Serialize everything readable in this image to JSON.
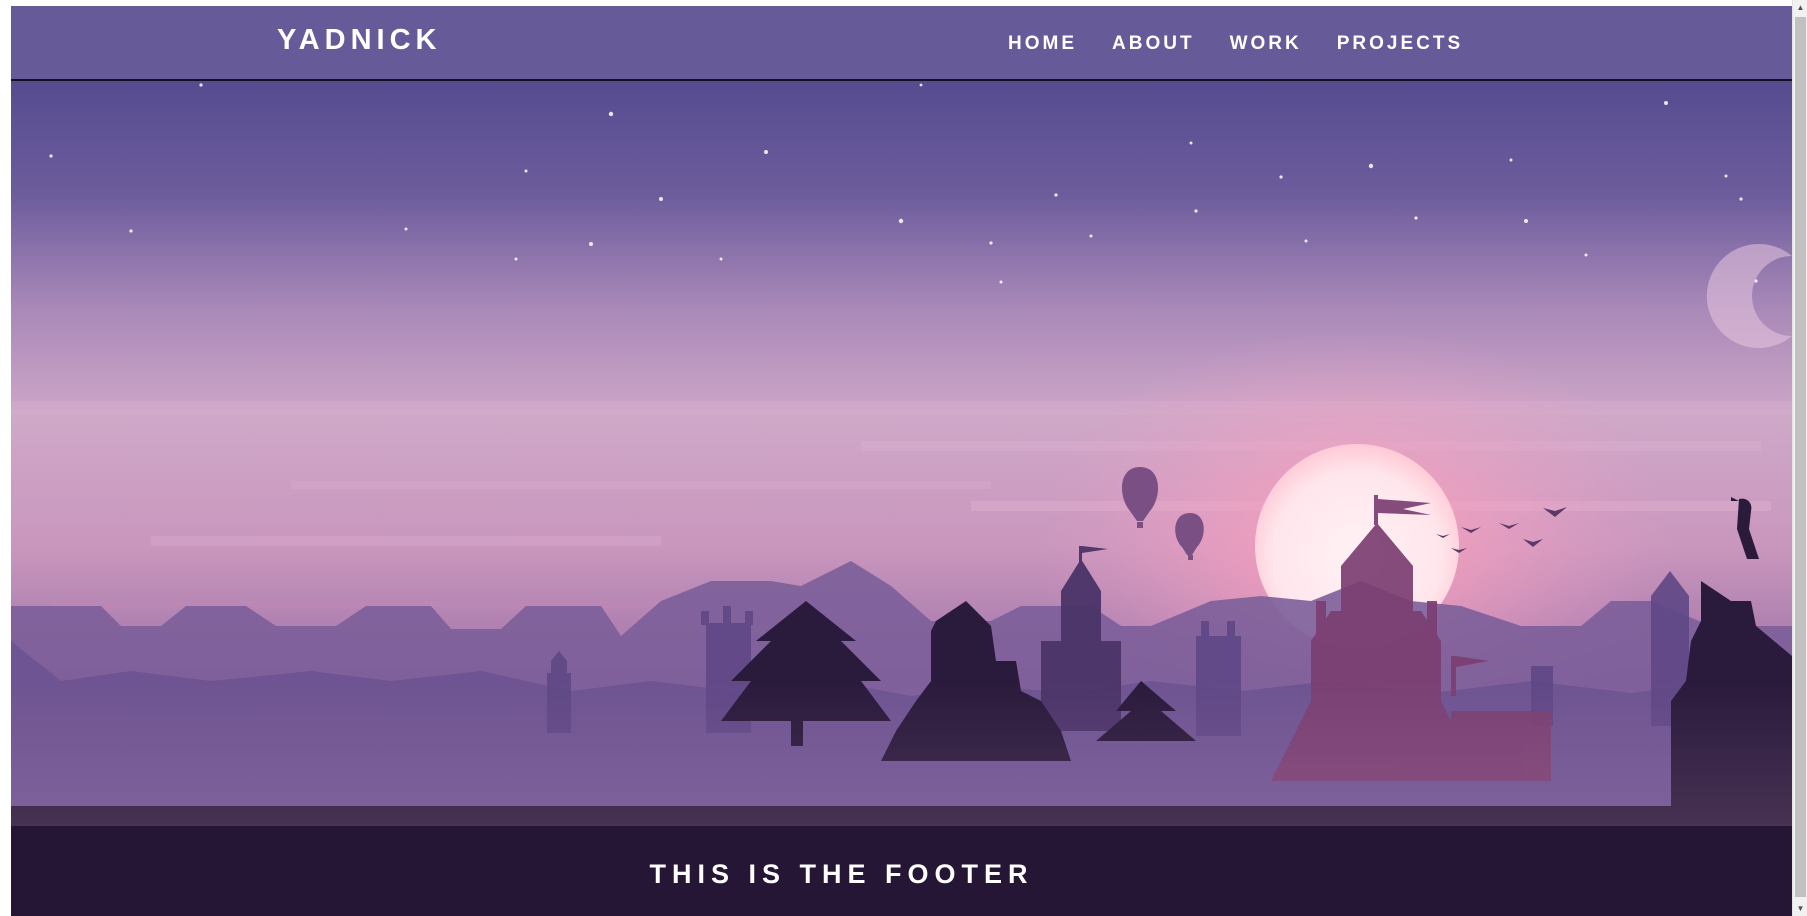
{
  "header": {
    "brand": "YADNICK",
    "nav": [
      "HOME",
      "ABOUT",
      "WORK",
      "PROJECTS"
    ]
  },
  "footer": {
    "text": "THIS IS THE FOOTER"
  },
  "colors": {
    "header_bg": "#665a98",
    "footer_bg": "#241634",
    "sky_top": "#564b90",
    "sky_mid": "#c8a3c4",
    "sun": "#fde9ee",
    "silhouette": "#2a1a3c"
  },
  "icons": {
    "scroll_up": "triangle-up",
    "scroll_down": "triangle-down"
  }
}
